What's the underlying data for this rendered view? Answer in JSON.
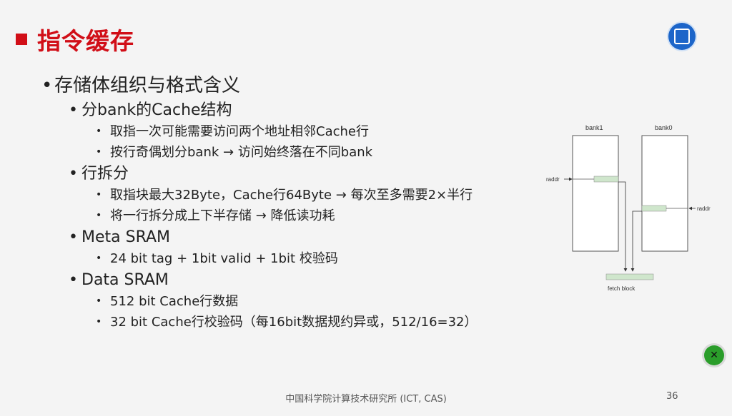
{
  "slide": {
    "title": "指令缓存",
    "footer": "中国科学院计算技术研究所 (ICT, CAS)",
    "page_number": "36"
  },
  "bullets": {
    "l1_0": "存储体组织与格式含义",
    "l2_0": "分bank的Cache结构",
    "l3_0": "取指一次可能需要访问两个地址相邻Cache行",
    "l3_1": "按行奇偶划分bank → 访问始终落在不同bank",
    "l2_1": "行拆分",
    "l3_2": "取指块最大32Byte，Cache行64Byte → 每次至多需要2×半行",
    "l3_3": "将一行拆分成上下半存储 → 降低读功耗",
    "l2_2": "Meta SRAM",
    "l3_4": "24 bit tag + 1bit valid + 1bit 校验码",
    "l2_3": "Data SRAM",
    "l3_5": "512 bit Cache行数据",
    "l3_6": "32 bit Cache行校验码（每16bit数据规约异或，512/16=32）"
  },
  "diagram": {
    "bank1_label": "bank1",
    "bank0_label": "bank0",
    "raddr_left": "raddr",
    "raddr_right": "raddr",
    "fetch_block_label": "fetch block",
    "highlight_color": "#cfe6cc"
  },
  "icons": {
    "top_right_logo": "classroom-logo-icon",
    "bottom_right_button": "close-icon"
  },
  "colors": {
    "title_red": "#d10e17",
    "logo_blue": "#1c65c9",
    "fab_green": "#2a9d2a"
  }
}
